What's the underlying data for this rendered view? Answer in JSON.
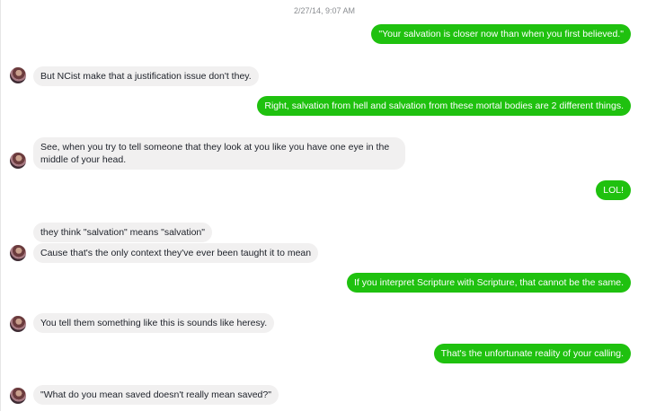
{
  "timestamp": "2/27/14, 9:07 AM",
  "messages": [
    {
      "side": "out",
      "text": "\"Your salvation is closer now than when you first believed.\""
    },
    {
      "side": "in",
      "text": "But NCist make that a justification issue don't they."
    },
    {
      "side": "out",
      "text": "Right, salvation from hell and salvation from these mortal bodies are 2 different things."
    },
    {
      "side": "in",
      "text": "See, when you try to tell someone that they look at you like you have one eye in the middle of your head."
    },
    {
      "side": "out",
      "text": "LOL!"
    },
    {
      "side": "in",
      "text": "they think \"salvation\" means \"salvation\""
    },
    {
      "side": "in",
      "text": "Cause that's the only context they've ever been taught it to mean"
    },
    {
      "side": "out",
      "text": "If you interpret Scripture with Scripture, that cannot be the same."
    },
    {
      "side": "in",
      "text": "You tell them something like this is sounds like heresy."
    },
    {
      "side": "out",
      "text": "That's the unfortunate reality of your calling."
    },
    {
      "side": "in",
      "text": "\"What do you mean saved doesn't really mean saved?\""
    }
  ],
  "colors": {
    "outgoing_bubble": "#1fc10f",
    "incoming_bubble": "#f1f0f0",
    "timestamp_text": "#8a8d91"
  },
  "icons": {
    "avatar": "contact-avatar-icon"
  }
}
